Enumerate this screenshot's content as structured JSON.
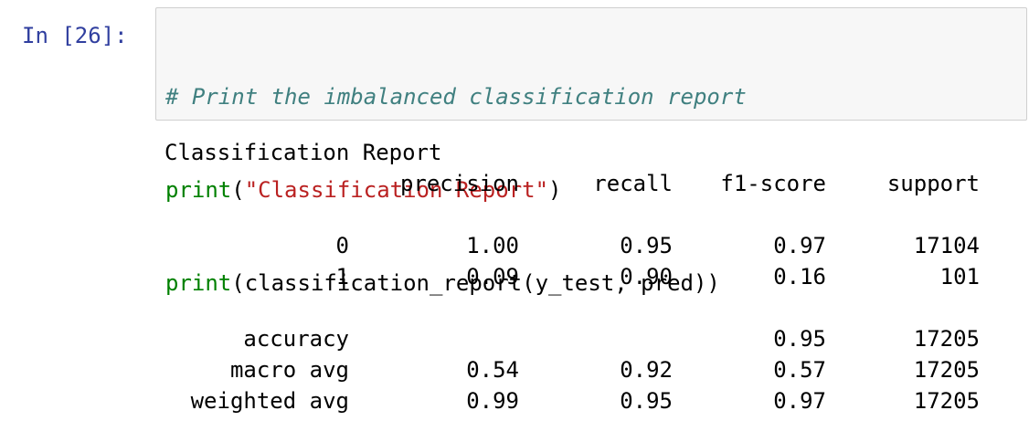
{
  "prompt": "In [26]:",
  "code": {
    "line1_comment": "# Print the imbalanced classification report",
    "line2_func": "print",
    "line2_open": "(",
    "line2_string": "\"Classification Report\"",
    "line2_close": ")",
    "line3_func": "print",
    "line3_rest": "(classification_report(y_test, pred))"
  },
  "output": {
    "title": "Classification Report",
    "headers": [
      "precision",
      "recall",
      "f1-score",
      "support"
    ],
    "rows": [
      {
        "label": "0",
        "precision": "1.00",
        "recall": "0.95",
        "f1": "0.97",
        "support": "17104"
      },
      {
        "label": "1",
        "precision": "0.09",
        "recall": "0.90",
        "f1": "0.16",
        "support": "101"
      }
    ],
    "summary": [
      {
        "label": "accuracy",
        "precision": "",
        "recall": "",
        "f1": "0.95",
        "support": "17205"
      },
      {
        "label": "macro avg",
        "precision": "0.54",
        "recall": "0.92",
        "f1": "0.57",
        "support": "17205"
      },
      {
        "label": "weighted avg",
        "precision": "0.99",
        "recall": "0.95",
        "f1": "0.97",
        "support": "17205"
      }
    ]
  },
  "colors": {
    "prompt": "#303F9F",
    "comment": "#408080",
    "builtin": "#008000",
    "string": "#BA2121",
    "cell_background": "#f7f7f7",
    "cell_border": "#cfcfcf"
  }
}
